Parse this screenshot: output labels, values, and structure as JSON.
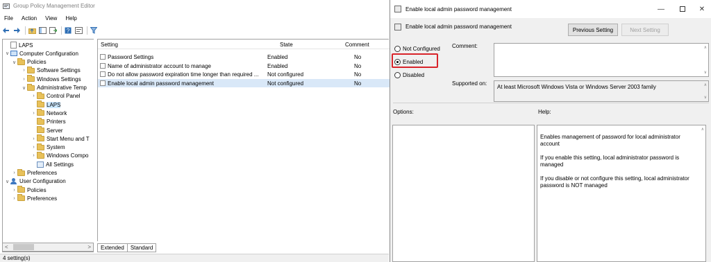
{
  "main_window": {
    "title": "Group Policy Management Editor",
    "menu": [
      "File",
      "Action",
      "View",
      "Help"
    ],
    "tree": [
      {
        "label": "LAPS",
        "level": 0,
        "chevron": "",
        "icon": "doc"
      },
      {
        "label": "Computer Configuration",
        "level": 0,
        "chevron": "v",
        "icon": "pc"
      },
      {
        "label": "Policies",
        "level": 1,
        "chevron": "v",
        "icon": "folder"
      },
      {
        "label": "Software Settings",
        "level": 2,
        "chevron": ">",
        "icon": "folder"
      },
      {
        "label": "Windows Settings",
        "level": 2,
        "chevron": ">",
        "icon": "folder"
      },
      {
        "label": "Administrative Temp",
        "level": 2,
        "chevron": "v",
        "icon": "folder"
      },
      {
        "label": "Control Panel",
        "level": 3,
        "chevron": ">",
        "icon": "folder"
      },
      {
        "label": "LAPS",
        "level": 3,
        "chevron": "",
        "icon": "folder",
        "selected": true
      },
      {
        "label": "Network",
        "level": 3,
        "chevron": ">",
        "icon": "folder"
      },
      {
        "label": "Printers",
        "level": 3,
        "chevron": "",
        "icon": "folder"
      },
      {
        "label": "Server",
        "level": 3,
        "chevron": "",
        "icon": "folder"
      },
      {
        "label": "Start Menu and T",
        "level": 3,
        "chevron": ">",
        "icon": "folder"
      },
      {
        "label": "System",
        "level": 3,
        "chevron": ">",
        "icon": "folder"
      },
      {
        "label": "Windows Compo",
        "level": 3,
        "chevron": ">",
        "icon": "folder"
      },
      {
        "label": "All Settings",
        "level": 3,
        "chevron": "",
        "icon": "allset"
      },
      {
        "label": "Preferences",
        "level": 1,
        "chevron": ">",
        "icon": "folder"
      },
      {
        "label": "User Configuration",
        "level": 0,
        "chevron": "v",
        "icon": "user"
      },
      {
        "label": "Policies",
        "level": 1,
        "chevron": ">",
        "icon": "folder"
      },
      {
        "label": "Preferences",
        "level": 1,
        "chevron": ">",
        "icon": "folder"
      }
    ],
    "list": {
      "columns": {
        "setting": "Setting",
        "state": "State",
        "comment": "Comment"
      },
      "rows": [
        {
          "setting": "Password Settings",
          "state": "Enabled",
          "comment": "No"
        },
        {
          "setting": "Name of administrator account to manage",
          "state": "Enabled",
          "comment": "No"
        },
        {
          "setting": "Do not allow password expiration time longer than required ...",
          "state": "Not configured",
          "comment": "No"
        },
        {
          "setting": "Enable local admin password management",
          "state": "Not configured",
          "comment": "No",
          "selected": true
        }
      ]
    },
    "tabs": [
      "Extended",
      "Standard"
    ],
    "status": "4 setting(s)"
  },
  "dialog": {
    "title": "Enable local admin password management",
    "setting_name": "Enable local admin password management",
    "previous_label": "Previous Setting",
    "next_label": "Next Setting",
    "options": {
      "not_configured": "Not Configured",
      "enabled": "Enabled",
      "disabled": "Disabled",
      "selected": "enabled"
    },
    "comment_label": "Comment:",
    "supported_label": "Supported on:",
    "supported_value": "At least Microsoft Windows Vista or Windows Server 2003 family",
    "options_label": "Options:",
    "help_label": "Help:",
    "help_paragraphs": [
      "Enables management of password for local administrator account",
      "If you enable this setting, local administrator password is managed",
      "If you disable or not configure this setting, local administrator password is NOT managed"
    ],
    "highlight_color": "#d8232a"
  }
}
